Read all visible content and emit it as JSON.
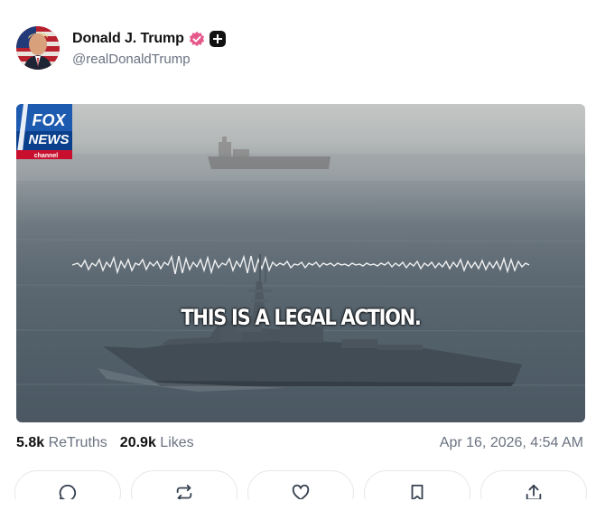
{
  "post": {
    "author": {
      "display_name": "Donald J. Trump",
      "handle": "@realDonaldTrump",
      "verified_badge_color": "#e55a8c",
      "icons": [
        "verified-badge-icon",
        "plus-badge-icon"
      ]
    },
    "media": {
      "caption": "THIS IS A LEGAL ACTION.",
      "logo_text": [
        "FOX",
        "NEWS",
        "channel"
      ]
    },
    "stats": {
      "retruths_count": "5.8k",
      "retruths_label": "ReTruths",
      "likes_count": "20.9k",
      "likes_label": "Likes",
      "timestamp": "Apr 16, 2026, 4:54 AM"
    },
    "actions": [
      "reply-icon",
      "retruth-icon",
      "like-icon",
      "bookmark-icon",
      "share-icon"
    ]
  }
}
